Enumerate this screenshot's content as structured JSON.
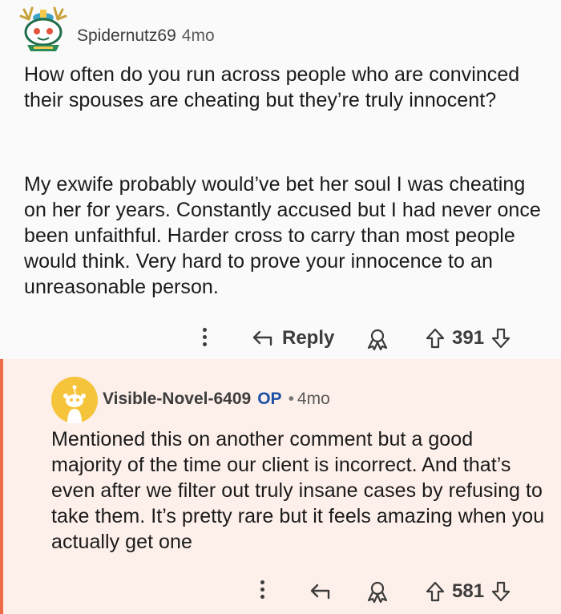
{
  "parent_comment": {
    "username": "Spidernutz69",
    "time": "4mo",
    "avatar": "snoo-avatar-icon",
    "paragraph_1": "How often do you run across people who are convinced their spouses are cheating but they’re truly innocent?",
    "paragraph_2": "My exwife probably would’ve bet her soul I was cheating on her for years. Constantly accused but I had never once been unfaithful. Harder cross to carry than most people would think. Very hard to prove your innocence to an unreasonable person.",
    "actions": {
      "reply_label": "Reply",
      "votes": "391"
    }
  },
  "reply_comment": {
    "username": "Visible-Novel-6409",
    "op_badge": "OP",
    "separator": "•",
    "time": "4mo",
    "avatar": "default-avatar-icon",
    "paragraph": "Mentioned this on another comment but a good majority of the time our client is incorrect. And that’s even after we filter out truly insane cases by refusing to take them. It’s pretty rare but it feels amazing when you actually get one",
    "actions": {
      "votes": "581"
    }
  },
  "colors": {
    "thread_line": "#ee6b48",
    "reply_background": "#fdefe9",
    "op_badge": "#1d4fa6"
  }
}
